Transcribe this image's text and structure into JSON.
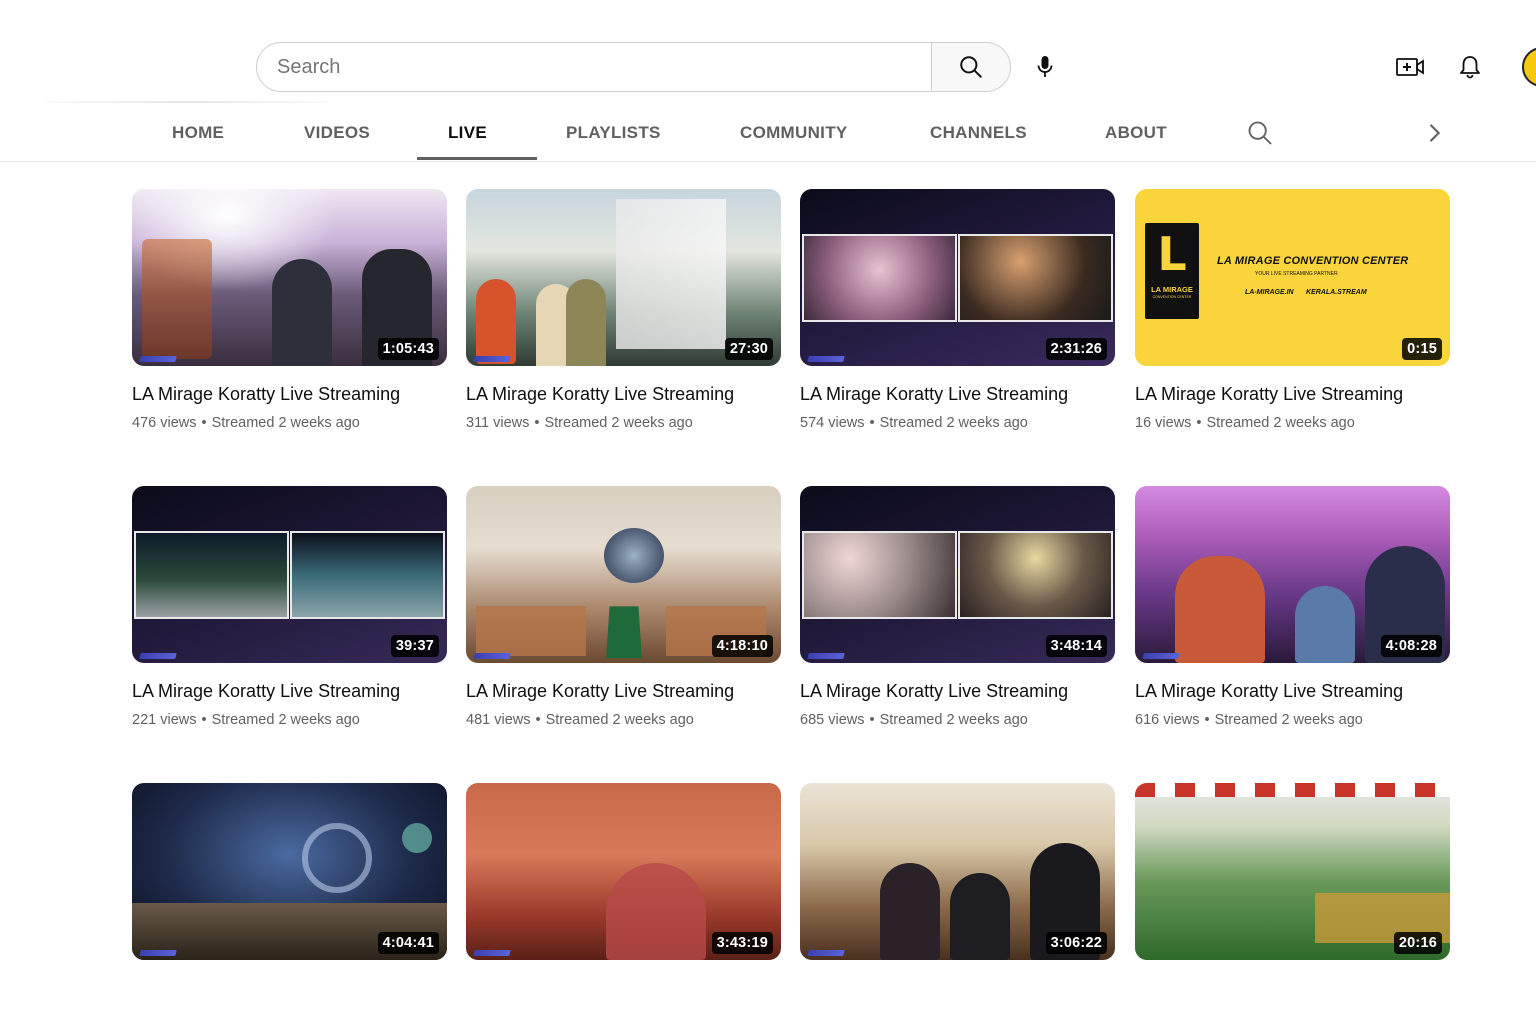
{
  "search": {
    "placeholder": "Search"
  },
  "icons": {
    "search": "search-icon",
    "mic": "microphone-icon",
    "create": "video-create-icon",
    "bell": "bell-icon",
    "tab_search": "search-icon",
    "chevron": "chevron-right-icon"
  },
  "tabs": [
    {
      "label": "HOME"
    },
    {
      "label": "VIDEOS"
    },
    {
      "label": "LIVE"
    },
    {
      "label": "PLAYLISTS"
    },
    {
      "label": "COMMUNITY"
    },
    {
      "label": "CHANNELS"
    },
    {
      "label": "ABOUT"
    }
  ],
  "active_tab": "LIVE",
  "logo_card": {
    "mark": "L",
    "mark_sub": "LA MIRAGE",
    "mark_sub2": "CONVENTION CENTER",
    "title": "LA MIRAGE CONVENTION CENTER",
    "subtitle": "YOUR LIVE STREAMING PARTNER",
    "link1": "LA-MIRAGE.IN",
    "link2": "KERALA.STREAM"
  },
  "colors": {
    "accent_yellow": "#f9d43a",
    "brand_black": "#0f0f0f",
    "meta_gray": "#606060"
  },
  "videos": [
    {
      "title": "LA Mirage Koratty Live Streaming",
      "views": "476 views",
      "age": "Streamed 2 weeks ago",
      "duration": "1:05:43"
    },
    {
      "title": "LA Mirage Koratty Live Streaming",
      "views": "311 views",
      "age": "Streamed 2 weeks ago",
      "duration": "27:30"
    },
    {
      "title": "LA Mirage Koratty Live Streaming",
      "views": "574 views",
      "age": "Streamed 2 weeks ago",
      "duration": "2:31:26"
    },
    {
      "title": "LA Mirage Koratty Live Streaming",
      "views": "16 views",
      "age": "Streamed 2 weeks ago",
      "duration": "0:15"
    },
    {
      "title": "LA Mirage Koratty Live Streaming",
      "views": "221 views",
      "age": "Streamed 2 weeks ago",
      "duration": "39:37"
    },
    {
      "title": "LA Mirage Koratty Live Streaming",
      "views": "481 views",
      "age": "Streamed 2 weeks ago",
      "duration": "4:18:10"
    },
    {
      "title": "LA Mirage Koratty Live Streaming",
      "views": "685 views",
      "age": "Streamed 2 weeks ago",
      "duration": "3:48:14"
    },
    {
      "title": "LA Mirage Koratty Live Streaming",
      "views": "616 views",
      "age": "Streamed 2 weeks ago",
      "duration": "4:08:28"
    },
    {
      "duration": "4:04:41"
    },
    {
      "duration": "3:43:19"
    },
    {
      "duration": "3:06:22"
    },
    {
      "duration": "20:16"
    }
  ]
}
